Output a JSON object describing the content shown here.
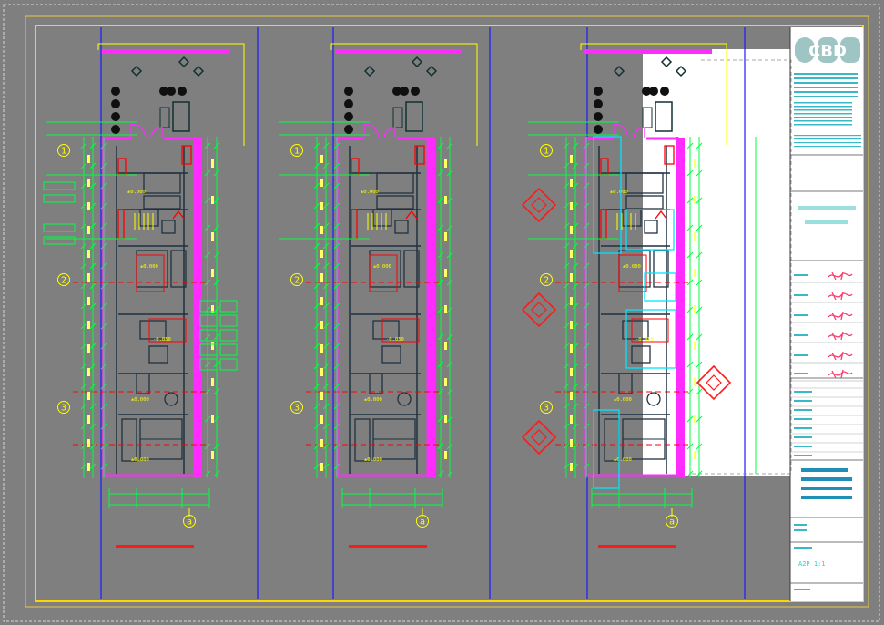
{
  "drawing": {
    "grid_markers": [
      "1",
      "2",
      "3"
    ],
    "axis_marker": "a",
    "elevation_main": "±0.000",
    "elevation_step": "-0.050",
    "elevation_alt": "+0.050"
  },
  "colors": {
    "background": "#7f7f7f",
    "frame": "#ffd400",
    "wall": "#ff2bff",
    "dimension": "#00ff40",
    "axis": "#1a1aff",
    "centerline": "#ff0000",
    "cyan": "#00e5ff",
    "furniture": "#1f3140",
    "titleblock_bg": "#ffffff"
  },
  "titleblock": {
    "logo": "CBD",
    "scale_label": "A2P 1:1"
  }
}
